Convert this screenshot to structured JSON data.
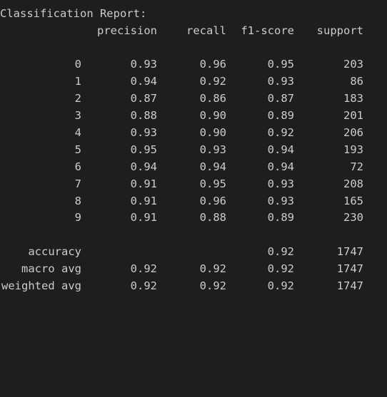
{
  "report": {
    "title": "Classification Report:",
    "headers": [
      "precision",
      "recall",
      "f1-score",
      "support"
    ],
    "classes": [
      {
        "label": "0",
        "precision": "0.93",
        "recall": "0.96",
        "f1": "0.95",
        "support": "203"
      },
      {
        "label": "1",
        "precision": "0.94",
        "recall": "0.92",
        "f1": "0.93",
        "support": "86"
      },
      {
        "label": "2",
        "precision": "0.87",
        "recall": "0.86",
        "f1": "0.87",
        "support": "183"
      },
      {
        "label": "3",
        "precision": "0.88",
        "recall": "0.90",
        "f1": "0.89",
        "support": "201"
      },
      {
        "label": "4",
        "precision": "0.93",
        "recall": "0.90",
        "f1": "0.92",
        "support": "206"
      },
      {
        "label": "5",
        "precision": "0.95",
        "recall": "0.93",
        "f1": "0.94",
        "support": "193"
      },
      {
        "label": "6",
        "precision": "0.94",
        "recall": "0.94",
        "f1": "0.94",
        "support": "72"
      },
      {
        "label": "7",
        "precision": "0.91",
        "recall": "0.95",
        "f1": "0.93",
        "support": "208"
      },
      {
        "label": "8",
        "precision": "0.91",
        "recall": "0.96",
        "f1": "0.93",
        "support": "165"
      },
      {
        "label": "9",
        "precision": "0.91",
        "recall": "0.88",
        "f1": "0.89",
        "support": "230"
      }
    ],
    "accuracy": {
      "label": "accuracy",
      "f1": "0.92",
      "support": "1747"
    },
    "macro_avg": {
      "label": "macro avg",
      "precision": "0.92",
      "recall": "0.92",
      "f1": "0.92",
      "support": "1747"
    },
    "weighted_avg": {
      "label": "weighted avg",
      "precision": "0.92",
      "recall": "0.92",
      "f1": "0.92",
      "support": "1747"
    }
  },
  "colors": {
    "background": "#1e1e1e",
    "text": "#cccccc"
  }
}
